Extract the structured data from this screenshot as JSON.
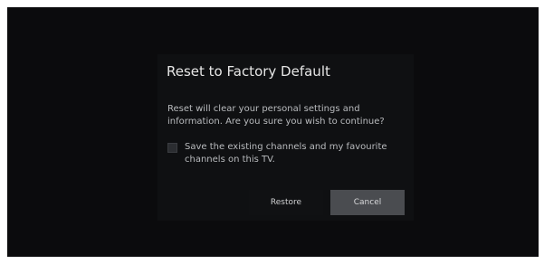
{
  "dialog": {
    "title": "Reset to Factory Default",
    "message": "Reset will clear your personal settings and information. Are you sure you wish to continue?",
    "checkbox": {
      "label": "Save the existing channels and my favourite channels on this TV.",
      "checked": false
    },
    "buttons": {
      "restore_label": "Restore",
      "cancel_label": "Cancel",
      "focused": "Cancel"
    }
  },
  "colors": {
    "screen_background": "#0b0b0d",
    "dialog_background": "#0f1012",
    "focused_button": "#4a4c50",
    "text_primary": "#e6e6e6",
    "text_secondary": "#b9bbbe"
  },
  "icons": {
    "checkbox": "empty-checkbox-icon"
  }
}
